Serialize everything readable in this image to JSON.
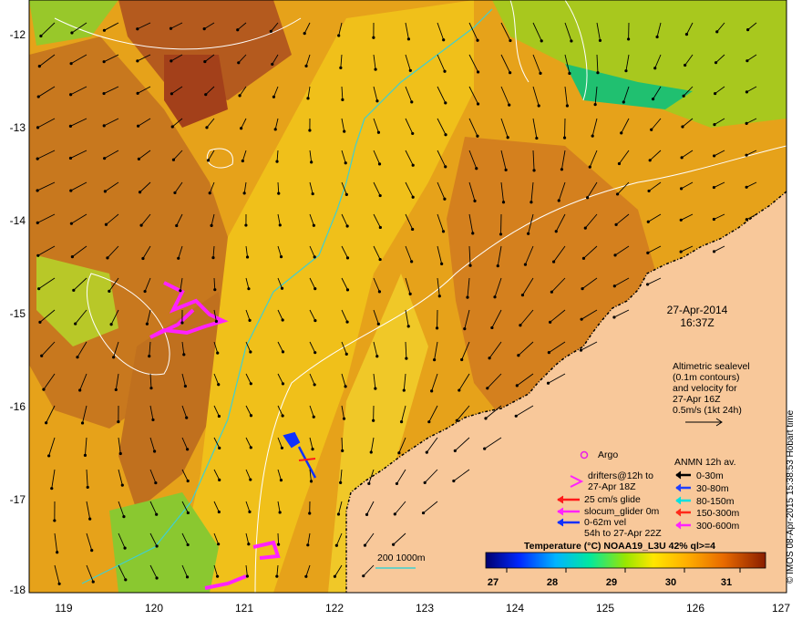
{
  "map": {
    "y_ticks": [
      "-12",
      "-13",
      "-14",
      "-15",
      "-16",
      "-17",
      "-18"
    ],
    "x_ticks": [
      "119",
      "120",
      "121",
      "122",
      "123",
      "124",
      "125",
      "126",
      "127"
    ],
    "lon_range": [
      118.6,
      127.0
    ],
    "lat_range": [
      -11.8,
      -18.0
    ]
  },
  "annotations": {
    "date": "27-Apr-2014",
    "time": "16:37Z",
    "altimetric_lines": [
      "Altimetric sealevel",
      "(0.1m contours)",
      "and velocity for",
      "27-Apr 16Z",
      "0.5m/s (1kt 24h)"
    ],
    "credit": "© IMOS 08-Apr-2015 15:38:53 Hobart time"
  },
  "legend": {
    "argo": "Argo",
    "drifters_lines": [
      "drifters@12h to",
      "27-Apr 18Z"
    ],
    "glide": "25 cm/s glide",
    "slocum": "slocum_glider 0m",
    "vel_lines": [
      "0-62m vel",
      "54h to 27-Apr 22Z"
    ],
    "anmn_title": "ANMN 12h av.",
    "anmn_items": [
      {
        "label": "0-30m",
        "color": "#000000"
      },
      {
        "label": "30-80m",
        "color": "#1f3fff"
      },
      {
        "label": "80-150m",
        "color": "#00e0e0"
      },
      {
        "label": "150-300m",
        "color": "#ff2a1a"
      },
      {
        "label": "300-600m",
        "color": "#ff22ff"
      }
    ],
    "depth_legend": "200  1000m"
  },
  "colorbar": {
    "title": "Temperature (°C) NOAA19_L3U 42% ql>=4",
    "labels": [
      "27",
      "28",
      "29",
      "30",
      "31"
    ],
    "range": [
      26.7,
      31.7
    ]
  },
  "colors": {
    "land": "#f8c89a",
    "argo": "#e81ee8",
    "drifter": "#ff22ff",
    "glide": "#ff1a1a",
    "slocum": "#ff22ff",
    "vel": "#1030ff",
    "contour_200": "#40cfd0",
    "ssh_contour": "#ffffff"
  }
}
